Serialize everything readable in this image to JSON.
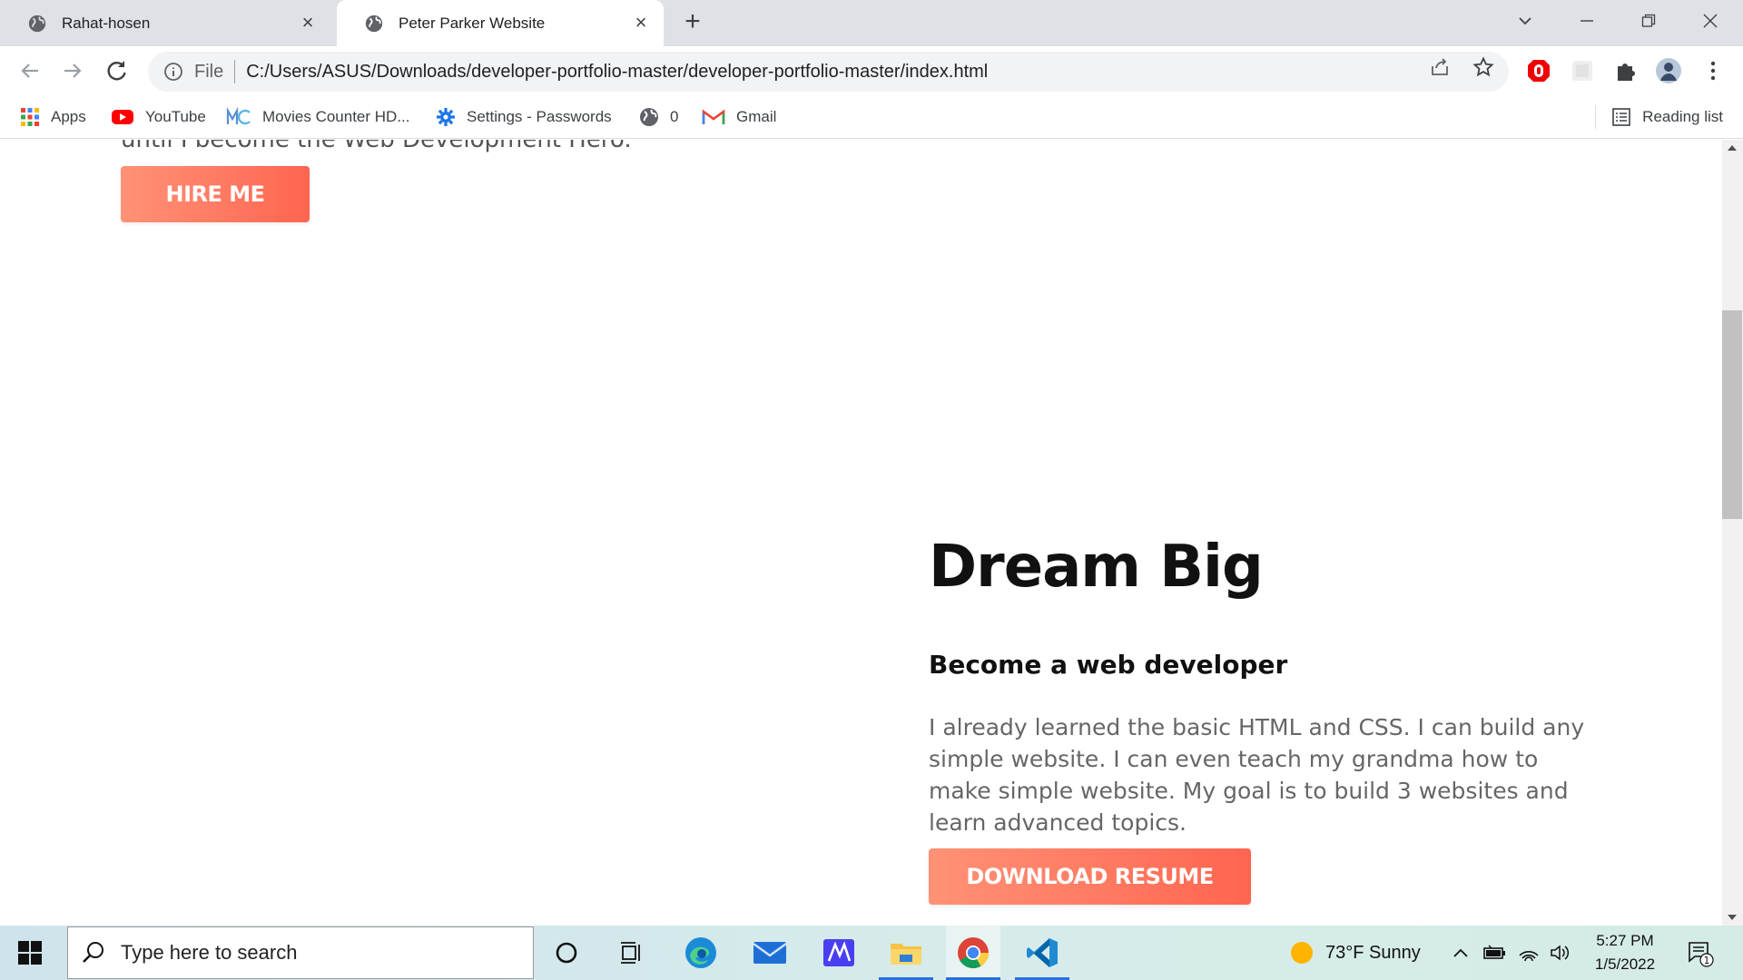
{
  "browser": {
    "tabs": [
      {
        "title": "Rahat-hosen",
        "active": false
      },
      {
        "title": "Peter Parker Website",
        "active": true
      }
    ],
    "omnibox": {
      "scheme_label": "File",
      "url": "C:/Users/ASUS/Downloads/developer-portfolio-master/developer-portfolio-master/index.html"
    },
    "bookmarks": [
      {
        "label": "Apps",
        "icon": "apps-grid-icon"
      },
      {
        "label": "YouTube",
        "icon": "youtube-icon"
      },
      {
        "label": "Movies Counter HD...",
        "icon": "mc-logo-icon"
      },
      {
        "label": "Settings - Passwords",
        "icon": "gear-icon"
      },
      {
        "label": "0",
        "icon": "globe-icon"
      },
      {
        "label": "Gmail",
        "icon": "gmail-icon"
      }
    ],
    "reading_list_label": "Reading list"
  },
  "page": {
    "intro_tail": "until I become the Web Development Hero.",
    "hire_button": "HIRE ME",
    "dream_title": "Dream Big",
    "dream_subtitle": "Become a web developer",
    "dream_text": "I already learned the basic HTML and CSS. I can build any simple website. I can even teach my grandma how to make simple website. My goal is to build 3 websites and learn advanced topics.",
    "resume_button": "DOWNLOAD RESUME",
    "accent_color": "#ff7a5f"
  },
  "taskbar": {
    "search_placeholder": "Type here to search",
    "weather": "73°F  Sunny",
    "time": "5:27 PM",
    "date": "1/5/2022",
    "notification_count": "1"
  }
}
